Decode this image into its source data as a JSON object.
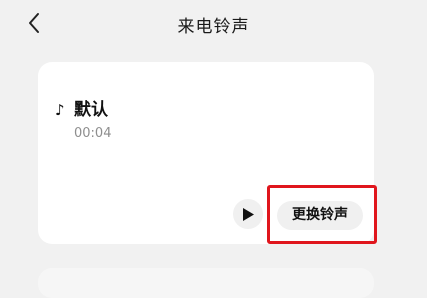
{
  "header": {
    "back_icon": "chevron-left-icon",
    "title": "来电铃声"
  },
  "ringtone": {
    "note_icon": "♪",
    "name": "默认",
    "duration": "00:04",
    "play_icon": "play-icon",
    "change_label": "更换铃声"
  },
  "colors": {
    "background": "#f1f1f1",
    "card": "#ffffff",
    "button_bg": "#f0f0f0",
    "highlight": "#e0161d",
    "secondary_text": "#8e8e8e"
  }
}
